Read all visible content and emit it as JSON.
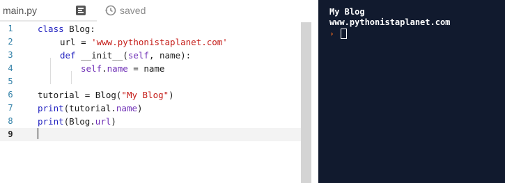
{
  "tabbar": {
    "file_name": "main.py",
    "files_icon": "files-icon",
    "saved_icon": "history-icon",
    "saved_label": "saved"
  },
  "editor": {
    "lines": [
      {
        "number": "1",
        "text": "class Blog:"
      },
      {
        "number": "2",
        "text": "url = 'www.pythonistaplanet.com'"
      },
      {
        "number": "3",
        "text": "def __init__(self, name):"
      },
      {
        "number": "4",
        "text": "self.name = name"
      },
      {
        "number": "5",
        "text": ""
      },
      {
        "number": "6",
        "text": "tutorial = Blog(\"My Blog\")"
      },
      {
        "number": "7",
        "text": "print(tutorial.name)"
      },
      {
        "number": "8",
        "text": "print(Blog.url)"
      },
      {
        "number": "9",
        "text": ""
      }
    ],
    "active_line": "9"
  },
  "console": {
    "output_lines": [
      "My Blog",
      "www.pythonistaplanet.com"
    ],
    "prompt_symbol": "›"
  },
  "colors": {
    "console_bg": "#111a2e",
    "keyword": "#1f1fbf",
    "string": "#c41a16",
    "property": "#6f2fb6",
    "line_number": "#2e7ea6",
    "prompt": "#f06a1e"
  }
}
